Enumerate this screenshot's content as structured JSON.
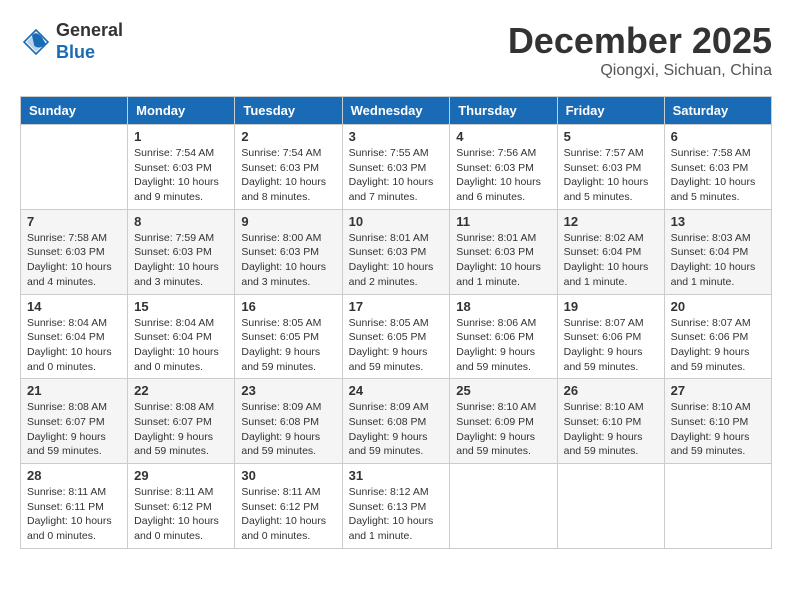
{
  "header": {
    "logo_general": "General",
    "logo_blue": "Blue",
    "month_title": "December 2025",
    "location": "Qiongxi, Sichuan, China"
  },
  "days_of_week": [
    "Sunday",
    "Monday",
    "Tuesday",
    "Wednesday",
    "Thursday",
    "Friday",
    "Saturday"
  ],
  "weeks": [
    [
      {
        "day": "",
        "info": ""
      },
      {
        "day": "1",
        "info": "Sunrise: 7:54 AM\nSunset: 6:03 PM\nDaylight: 10 hours\nand 9 minutes."
      },
      {
        "day": "2",
        "info": "Sunrise: 7:54 AM\nSunset: 6:03 PM\nDaylight: 10 hours\nand 8 minutes."
      },
      {
        "day": "3",
        "info": "Sunrise: 7:55 AM\nSunset: 6:03 PM\nDaylight: 10 hours\nand 7 minutes."
      },
      {
        "day": "4",
        "info": "Sunrise: 7:56 AM\nSunset: 6:03 PM\nDaylight: 10 hours\nand 6 minutes."
      },
      {
        "day": "5",
        "info": "Sunrise: 7:57 AM\nSunset: 6:03 PM\nDaylight: 10 hours\nand 5 minutes."
      },
      {
        "day": "6",
        "info": "Sunrise: 7:58 AM\nSunset: 6:03 PM\nDaylight: 10 hours\nand 5 minutes."
      }
    ],
    [
      {
        "day": "7",
        "info": "Sunrise: 7:58 AM\nSunset: 6:03 PM\nDaylight: 10 hours\nand 4 minutes."
      },
      {
        "day": "8",
        "info": "Sunrise: 7:59 AM\nSunset: 6:03 PM\nDaylight: 10 hours\nand 3 minutes."
      },
      {
        "day": "9",
        "info": "Sunrise: 8:00 AM\nSunset: 6:03 PM\nDaylight: 10 hours\nand 3 minutes."
      },
      {
        "day": "10",
        "info": "Sunrise: 8:01 AM\nSunset: 6:03 PM\nDaylight: 10 hours\nand 2 minutes."
      },
      {
        "day": "11",
        "info": "Sunrise: 8:01 AM\nSunset: 6:03 PM\nDaylight: 10 hours\nand 1 minute."
      },
      {
        "day": "12",
        "info": "Sunrise: 8:02 AM\nSunset: 6:04 PM\nDaylight: 10 hours\nand 1 minute."
      },
      {
        "day": "13",
        "info": "Sunrise: 8:03 AM\nSunset: 6:04 PM\nDaylight: 10 hours\nand 1 minute."
      }
    ],
    [
      {
        "day": "14",
        "info": "Sunrise: 8:04 AM\nSunset: 6:04 PM\nDaylight: 10 hours\nand 0 minutes."
      },
      {
        "day": "15",
        "info": "Sunrise: 8:04 AM\nSunset: 6:04 PM\nDaylight: 10 hours\nand 0 minutes."
      },
      {
        "day": "16",
        "info": "Sunrise: 8:05 AM\nSunset: 6:05 PM\nDaylight: 9 hours\nand 59 minutes."
      },
      {
        "day": "17",
        "info": "Sunrise: 8:05 AM\nSunset: 6:05 PM\nDaylight: 9 hours\nand 59 minutes."
      },
      {
        "day": "18",
        "info": "Sunrise: 8:06 AM\nSunset: 6:06 PM\nDaylight: 9 hours\nand 59 minutes."
      },
      {
        "day": "19",
        "info": "Sunrise: 8:07 AM\nSunset: 6:06 PM\nDaylight: 9 hours\nand 59 minutes."
      },
      {
        "day": "20",
        "info": "Sunrise: 8:07 AM\nSunset: 6:06 PM\nDaylight: 9 hours\nand 59 minutes."
      }
    ],
    [
      {
        "day": "21",
        "info": "Sunrise: 8:08 AM\nSunset: 6:07 PM\nDaylight: 9 hours\nand 59 minutes."
      },
      {
        "day": "22",
        "info": "Sunrise: 8:08 AM\nSunset: 6:07 PM\nDaylight: 9 hours\nand 59 minutes."
      },
      {
        "day": "23",
        "info": "Sunrise: 8:09 AM\nSunset: 6:08 PM\nDaylight: 9 hours\nand 59 minutes."
      },
      {
        "day": "24",
        "info": "Sunrise: 8:09 AM\nSunset: 6:08 PM\nDaylight: 9 hours\nand 59 minutes."
      },
      {
        "day": "25",
        "info": "Sunrise: 8:10 AM\nSunset: 6:09 PM\nDaylight: 9 hours\nand 59 minutes."
      },
      {
        "day": "26",
        "info": "Sunrise: 8:10 AM\nSunset: 6:10 PM\nDaylight: 9 hours\nand 59 minutes."
      },
      {
        "day": "27",
        "info": "Sunrise: 8:10 AM\nSunset: 6:10 PM\nDaylight: 9 hours\nand 59 minutes."
      }
    ],
    [
      {
        "day": "28",
        "info": "Sunrise: 8:11 AM\nSunset: 6:11 PM\nDaylight: 10 hours\nand 0 minutes."
      },
      {
        "day": "29",
        "info": "Sunrise: 8:11 AM\nSunset: 6:12 PM\nDaylight: 10 hours\nand 0 minutes."
      },
      {
        "day": "30",
        "info": "Sunrise: 8:11 AM\nSunset: 6:12 PM\nDaylight: 10 hours\nand 0 minutes."
      },
      {
        "day": "31",
        "info": "Sunrise: 8:12 AM\nSunset: 6:13 PM\nDaylight: 10 hours\nand 1 minute."
      },
      {
        "day": "",
        "info": ""
      },
      {
        "day": "",
        "info": ""
      },
      {
        "day": "",
        "info": ""
      }
    ]
  ]
}
